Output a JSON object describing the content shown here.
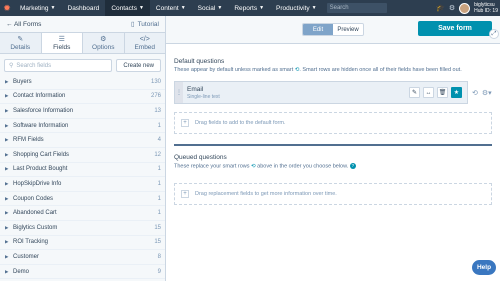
{
  "nav": {
    "marketing": "Marketing",
    "dashboard": "Dashboard",
    "contacts": "Contacts",
    "content": "Content",
    "social": "Social",
    "reports": "Reports",
    "productivity": "Productivity",
    "search_placeholder": "Search",
    "account_name": "biglyticsu",
    "hub_id": "Hub ID: 19"
  },
  "sidebar": {
    "back": "All Forms",
    "tutorial": "Tutorial",
    "tabs": [
      {
        "label": "Details",
        "icon": "pencil-icon"
      },
      {
        "label": "Fields",
        "icon": "fields-icon"
      },
      {
        "label": "Options",
        "icon": "gear-icon"
      },
      {
        "label": "Embed",
        "icon": "code-icon"
      }
    ],
    "search_placeholder": "Search fields",
    "create_new": "Create new",
    "groups": [
      {
        "label": "Buyers",
        "count": "130"
      },
      {
        "label": "Contact Information",
        "count": "276"
      },
      {
        "label": "Salesforce Information",
        "count": "13"
      },
      {
        "label": "Software Information",
        "count": "1"
      },
      {
        "label": "RFM Fields",
        "count": "4"
      },
      {
        "label": "Shopping Cart Fields",
        "count": "12"
      },
      {
        "label": "Last Product Bought",
        "count": "1"
      },
      {
        "label": "HopSkipDrive Info",
        "count": "1"
      },
      {
        "label": "Coupon Codes",
        "count": "1"
      },
      {
        "label": "Abandoned Cart",
        "count": "1"
      },
      {
        "label": "Biglytics Custom",
        "count": "15"
      },
      {
        "label": "ROI Tracking",
        "count": "15"
      },
      {
        "label": "Customer",
        "count": "8"
      },
      {
        "label": "Demo",
        "count": "9"
      }
    ]
  },
  "toolbar": {
    "edit": "Edit",
    "preview": "Preview",
    "save": "Save form"
  },
  "default_questions": {
    "title": "Default questions",
    "desc_before": "These appear by default unless marked as smart",
    "desc_after": ". Smart rows are hidden once all of their fields have been filled out.",
    "field_label": "Email",
    "field_type": "Single-line text",
    "drop_text": "Drag fields to add to the default form."
  },
  "queued_questions": {
    "title": "Queued questions",
    "desc_before": "These replace your smart rows",
    "desc_after": "above in the order you choose below.",
    "drop_text": "Drag replacement fields to get more information over time."
  },
  "help": "Help",
  "colors": {
    "accent": "#0091ae",
    "nav": "#2d3e50",
    "help": "#3a77c0"
  }
}
